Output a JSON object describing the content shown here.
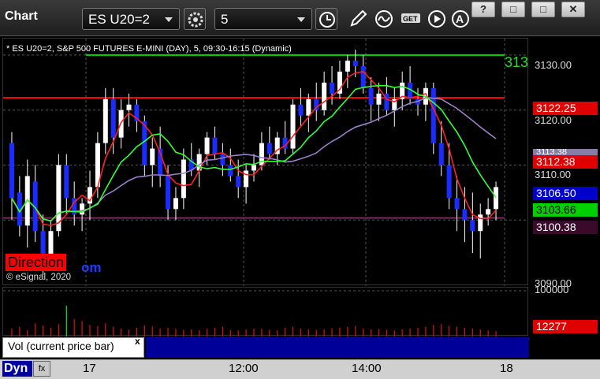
{
  "toolbar": {
    "title": "Chart",
    "symbol": "ES U20=2",
    "interval": "5",
    "window_buttons": [
      "?",
      "□",
      "□",
      "✕"
    ]
  },
  "chart": {
    "header": "* ES U20=2, S&P 500 FUTURES E-MINI (DAY), 5, 09:30-16:15 (Dynamic)",
    "copyright": "© eSignal, 2020",
    "watermark_left": "Direction",
    "watermark_right": "om",
    "price_stub": "313",
    "price_axis": [
      "3130.00",
      "3120.00",
      "3110.00",
      "3090.00"
    ],
    "price_tags": [
      {
        "text": "3122.25",
        "bg": "#e00000",
        "fg": "#ffffff"
      },
      {
        "text": "3113.38",
        "bg": "#8a7aa8",
        "fg": "#ffffff"
      },
      {
        "text": "3112.38",
        "bg": "#e00000",
        "fg": "#ffffff"
      },
      {
        "text": "3106.50",
        "bg": "#0000cc",
        "fg": "#ffffff"
      },
      {
        "text": "3103.66",
        "bg": "#00d000",
        "fg": "#000000"
      },
      {
        "text": "3100.38",
        "bg": "#3a0a2a",
        "fg": "#ffffff"
      }
    ],
    "vol_axis": "100000",
    "vol_tag": "12277",
    "vol_label": "Vol (current price bar)",
    "vol_close": "x",
    "time_labels": [
      "17",
      "12:00",
      "14:00",
      "18"
    ],
    "dyn_label": "Dyn",
    "fx_label": "fx"
  },
  "chart_data": {
    "type": "candlestick",
    "symbol": "ES U20=2",
    "ylim": [
      3088,
      3133
    ],
    "candles": [
      [
        3114,
        3116,
        3100,
        3104
      ],
      [
        3105,
        3108,
        3097,
        3099
      ],
      [
        3099,
        3111,
        3095,
        3108
      ],
      [
        3107,
        3110,
        3096,
        3098
      ],
      [
        3098,
        3101,
        3090,
        3092
      ],
      [
        3093,
        3100,
        3091,
        3098
      ],
      [
        3098,
        3112,
        3097,
        3110
      ],
      [
        3110,
        3112,
        3101,
        3104
      ],
      [
        3104,
        3107,
        3099,
        3101
      ],
      [
        3101,
        3104,
        3098,
        3103
      ],
      [
        3103,
        3109,
        3100,
        3106
      ],
      [
        3106,
        3116,
        3104,
        3114
      ],
      [
        3114,
        3124,
        3112,
        3122
      ],
      [
        3122,
        3124,
        3112,
        3115
      ],
      [
        3115,
        3122,
        3113,
        3120
      ],
      [
        3120,
        3123,
        3117,
        3121
      ],
      [
        3121,
        3122,
        3116,
        3118
      ],
      [
        3118,
        3119,
        3108,
        3110
      ],
      [
        3110,
        3115,
        3106,
        3113
      ],
      [
        3113,
        3117,
        3106,
        3108
      ],
      [
        3108,
        3110,
        3100,
        3102
      ],
      [
        3102,
        3106,
        3100,
        3104
      ],
      [
        3104,
        3113,
        3102,
        3111
      ],
      [
        3111,
        3114,
        3108,
        3109
      ],
      [
        3109,
        3113,
        3106,
        3112
      ],
      [
        3112,
        3116,
        3110,
        3115
      ],
      [
        3115,
        3117,
        3111,
        3112
      ],
      [
        3112,
        3114,
        3108,
        3110
      ],
      [
        3110,
        3113,
        3107,
        3108
      ],
      [
        3108,
        3111,
        3104,
        3106
      ],
      [
        3106,
        3110,
        3103,
        3109
      ],
      [
        3109,
        3112,
        3107,
        3110
      ],
      [
        3110,
        3116,
        3109,
        3114
      ],
      [
        3114,
        3117,
        3111,
        3112
      ],
      [
        3112,
        3116,
        3110,
        3115
      ],
      [
        3115,
        3118,
        3112,
        3113
      ],
      [
        3113,
        3122,
        3112,
        3121
      ],
      [
        3121,
        3124,
        3117,
        3119
      ],
      [
        3119,
        3123,
        3116,
        3122
      ],
      [
        3122,
        3125,
        3118,
        3120
      ],
      [
        3120,
        3127,
        3119,
        3125
      ],
      [
        3125,
        3128,
        3121,
        3123
      ],
      [
        3123,
        3129,
        3122,
        3127
      ],
      [
        3127,
        3130,
        3124,
        3129
      ],
      [
        3129,
        3131,
        3126,
        3128
      ],
      [
        3128,
        3130,
        3123,
        3124
      ],
      [
        3124,
        3126,
        3118,
        3121
      ],
      [
        3121,
        3125,
        3118,
        3123
      ],
      [
        3123,
        3126,
        3119,
        3120
      ],
      [
        3120,
        3124,
        3117,
        3122
      ],
      [
        3122,
        3127,
        3120,
        3125
      ],
      [
        3125,
        3128,
        3121,
        3122
      ],
      [
        3122,
        3124,
        3119,
        3121
      ],
      [
        3121,
        3125,
        3118,
        3124
      ],
      [
        3124,
        3125,
        3112,
        3114
      ],
      [
        3114,
        3118,
        3108,
        3110
      ],
      [
        3110,
        3114,
        3102,
        3104
      ],
      [
        3104,
        3108,
        3098,
        3102
      ],
      [
        3102,
        3106,
        3096,
        3100
      ],
      [
        3100,
        3105,
        3094,
        3098
      ],
      [
        3098,
        3103,
        3093,
        3101
      ],
      [
        3101,
        3104,
        3099,
        3102
      ],
      [
        3102,
        3107,
        3100,
        3106
      ]
    ],
    "series": [
      {
        "name": "red",
        "color": "#ff2020"
      },
      {
        "name": "purple",
        "color": "#9b7fc8"
      },
      {
        "name": "green",
        "color": "#33ff33"
      }
    ],
    "levels": [
      {
        "price": 3130.0,
        "color": "#00e000"
      },
      {
        "price": 3122.25,
        "color": "#ff0000"
      },
      {
        "price": 3100.38,
        "color": "#7a2a5a"
      }
    ],
    "volume_max": 100000,
    "volume": [
      18000,
      22000,
      15000,
      30000,
      25000,
      20000,
      28000,
      70000,
      40000,
      35000,
      26000,
      24000,
      30000,
      22000,
      18000,
      16000,
      20000,
      25000,
      22000,
      18000,
      20000,
      17000,
      15000,
      16000,
      14000,
      18000,
      20000,
      22000,
      15000,
      14000,
      16000,
      18000,
      17000,
      15000,
      14000,
      20000,
      22000,
      18000,
      16000,
      15000,
      17000,
      19000,
      20000,
      22000,
      24000,
      18000,
      16000,
      17000,
      15000,
      14000,
      16000,
      18000,
      20000,
      22000,
      26000,
      28000,
      24000,
      22000,
      20000,
      18000,
      16000,
      14000,
      12277
    ]
  }
}
